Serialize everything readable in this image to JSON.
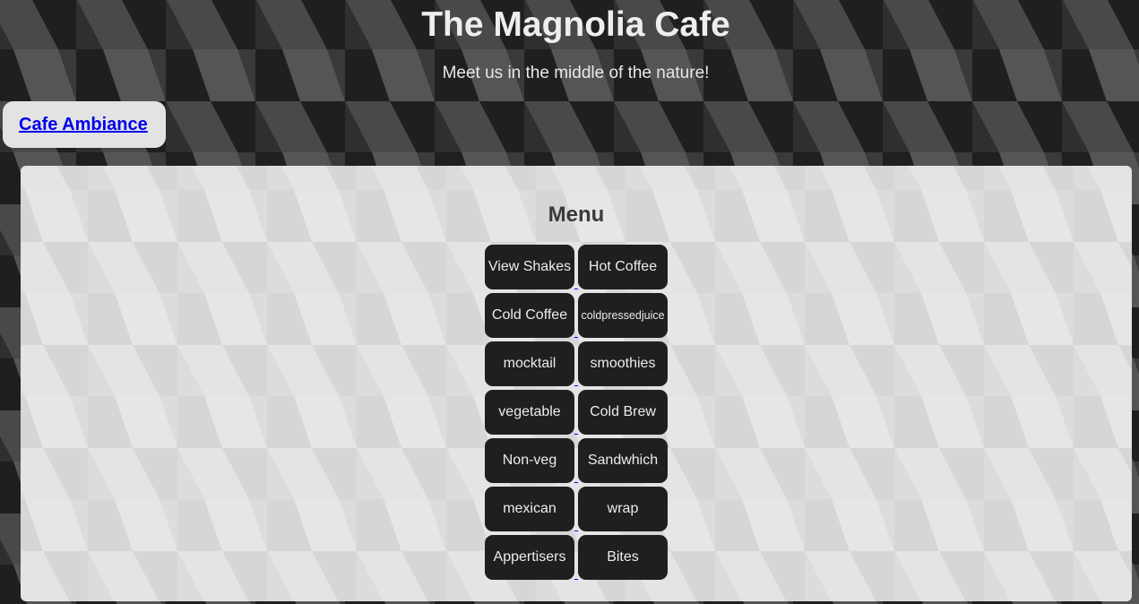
{
  "header": {
    "title": "The Magnolia Cafe",
    "tagline": "Meet us in the middle of the nature!"
  },
  "nav": {
    "ambiance_label": "Cafe Ambiance"
  },
  "menu": {
    "heading": "Menu",
    "items": [
      "View Shakes",
      "Hot Coffee",
      "Cold Coffee",
      "coldpressedjuice",
      "mocktail",
      "smoothies",
      "vegetable",
      "Cold Brew",
      "Non-veg",
      "Sandwhich",
      "mexican",
      "wrap",
      "Appertisers",
      "Bites"
    ]
  },
  "colors": {
    "button_bg": "#1f1f1f",
    "panel_bg": "#e0e0e0",
    "link": "#0000ee"
  }
}
